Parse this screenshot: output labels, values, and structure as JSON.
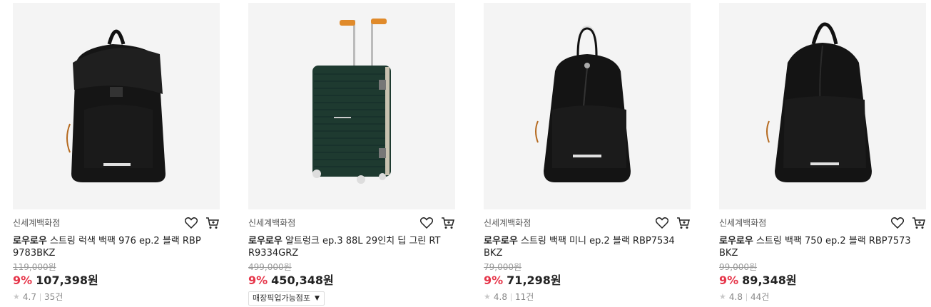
{
  "products": [
    {
      "seller": "신세계백화점",
      "brand": "로우로우",
      "name": " 스트링 럭색 백팩 976 ep.2 블랙 RBP9783BKZ",
      "original_price": "119,000원",
      "discount": "9%",
      "price": "107,398원",
      "rating": "4.7",
      "reviews": "35건"
    },
    {
      "seller": "신세계백화점",
      "brand": "로우로우",
      "name": " 알트렁크 ep.3 88L 29인치 딥 그린 RTR9334GRZ",
      "original_price": "499,000원",
      "discount": "9%",
      "price": "450,348원",
      "badge": "매장픽업가능점포"
    },
    {
      "seller": "신세계백화점",
      "brand": "로우로우",
      "name": " 스트링 백팩 미니 ep.2 블랙 RBP7534BKZ",
      "original_price": "79,000원",
      "discount": "9%",
      "price": "71,298원",
      "rating": "4.8",
      "reviews": "11건"
    },
    {
      "seller": "신세계백화점",
      "brand": "로우로우",
      "name": " 스트링 백팩 750 ep.2 블랙 RBP7573BKZ",
      "original_price": "99,000원",
      "discount": "9%",
      "price": "89,348원",
      "rating": "4.8",
      "reviews": "44건"
    }
  ],
  "icons": {
    "wishlist": "heart-outline-icon",
    "cart": "cart-icon",
    "star": "star-icon",
    "dropdown": "caret-down-icon"
  },
  "colors": {
    "discount": "#e6364a",
    "thumb_bg": "#f4f4f4",
    "muted": "#999999"
  }
}
